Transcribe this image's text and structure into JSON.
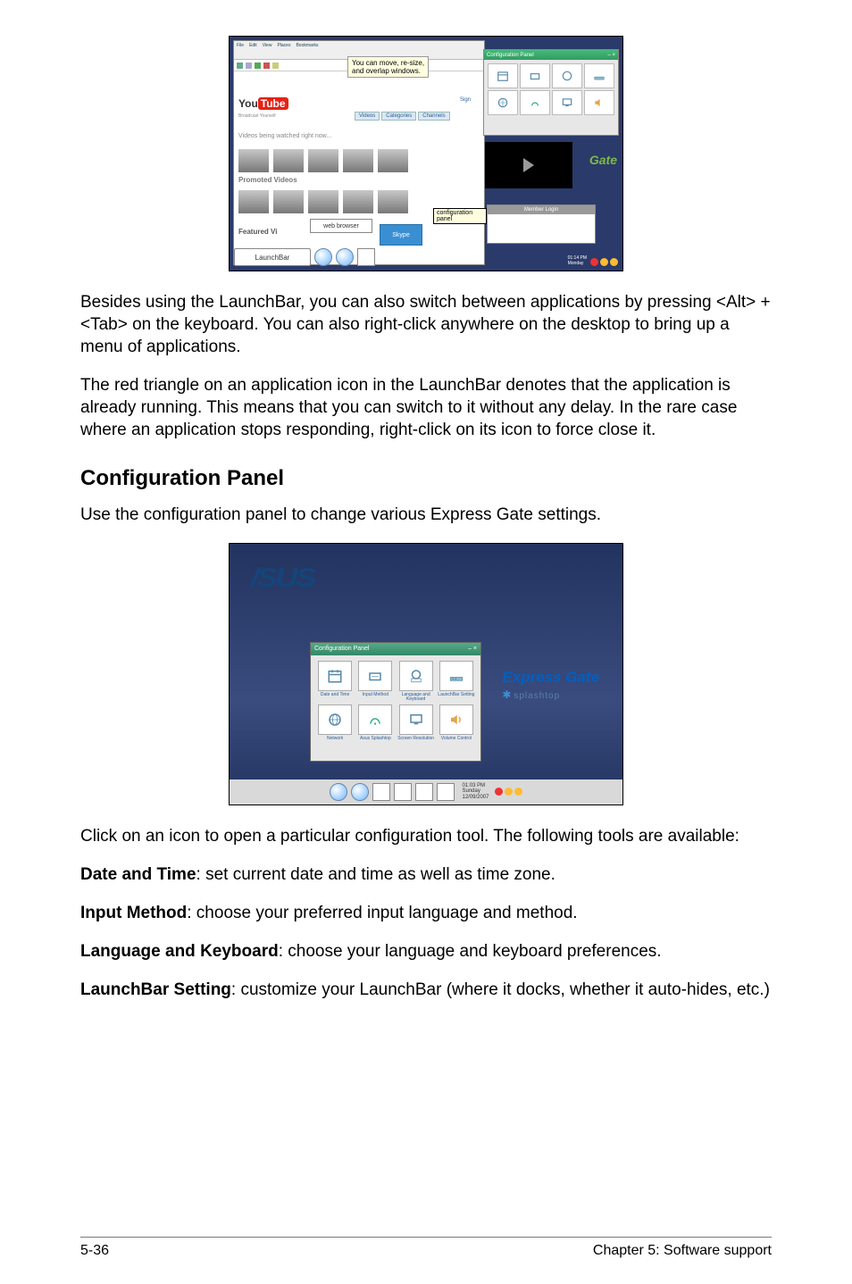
{
  "paragraphs": {
    "p1": "Besides using the LaunchBar, you can also switch between applications by pressing <Alt> +<Tab> on the keyboard. You can also right-click anywhere on the desktop to bring up a menu of applications.",
    "p2": "The red triangle on an application icon in the LaunchBar denotes that the application is already running. This means that you can switch to it without any delay. In the rare case where an application stops responding, right-click on its icon to force close it.",
    "heading": "Configuration Panel",
    "p3": "Use the configuration panel to change various Express Gate settings.",
    "p4": "Click on an icon to open a particular configuration tool. The following tools are available:",
    "tool1_name": "Date and Time",
    "tool1_desc": ": set current date and time as well as time zone.",
    "tool2_name": "Input Method",
    "tool2_desc": ": choose your preferred input language and method.",
    "tool3_name": "Language and Keyboard",
    "tool3_desc": ": choose your language and keyboard preferences.",
    "tool4_name": "LaunchBar Setting",
    "tool4_desc": ": customize your LaunchBar (where it docks, whether it auto-hides, etc.)"
  },
  "footer": {
    "left": "5-36",
    "right": "Chapter 5: Software support"
  },
  "fig1": {
    "menu": {
      "file": "File",
      "edit": "Edit",
      "view": "View",
      "places": "Places",
      "bookmarks": "Bookmarks"
    },
    "tooltip_l1": "You can move, re-size,",
    "tooltip_l2": "and overlap windows.",
    "yt_you": "You",
    "yt_tube": "Tube",
    "signup": "Sign",
    "tabs": {
      "videos": "Videos",
      "categories": "Categories",
      "channels": "Channels"
    },
    "broadcast": "Broadcast Yourself",
    "watched": "Videos being watched right now...",
    "promoted": "Promoted Videos",
    "featured": "Featured Vi",
    "webbrowser": "web browser",
    "skype": "Skype",
    "cfg_title": "Configuration Panel",
    "cfg_close": "– ×",
    "cfg_items": [
      "Date and Time",
      "Input Method",
      "Language and Keyboard",
      "LaunchBar Setting",
      "Network",
      "Asus Splashtop",
      "Screen Resolution",
      "Volume Control"
    ],
    "gate": "Gate",
    "callout_l1": "configuration",
    "callout_l2": "panel",
    "memberlogin": "Member Login",
    "launchbar_label": "LaunchBar",
    "clock_time": "01:14 PM",
    "clock_day": "Monday"
  },
  "fig2": {
    "asus_logo": "/SUS",
    "panel_title": "Configuration Panel",
    "panel_close": "– ×",
    "items": [
      "Date and Time",
      "Input Method",
      "Language and Keyboard",
      "LaunchBar Setting",
      "Network",
      "Asus Splashtop",
      "Screen Resolution",
      "Volume Control"
    ],
    "express_gate": "Express Gate",
    "splashtop": "splashtop",
    "clock_time": "01:03 PM",
    "clock_day": "Sunday",
    "clock_date": "12/09/2007"
  }
}
